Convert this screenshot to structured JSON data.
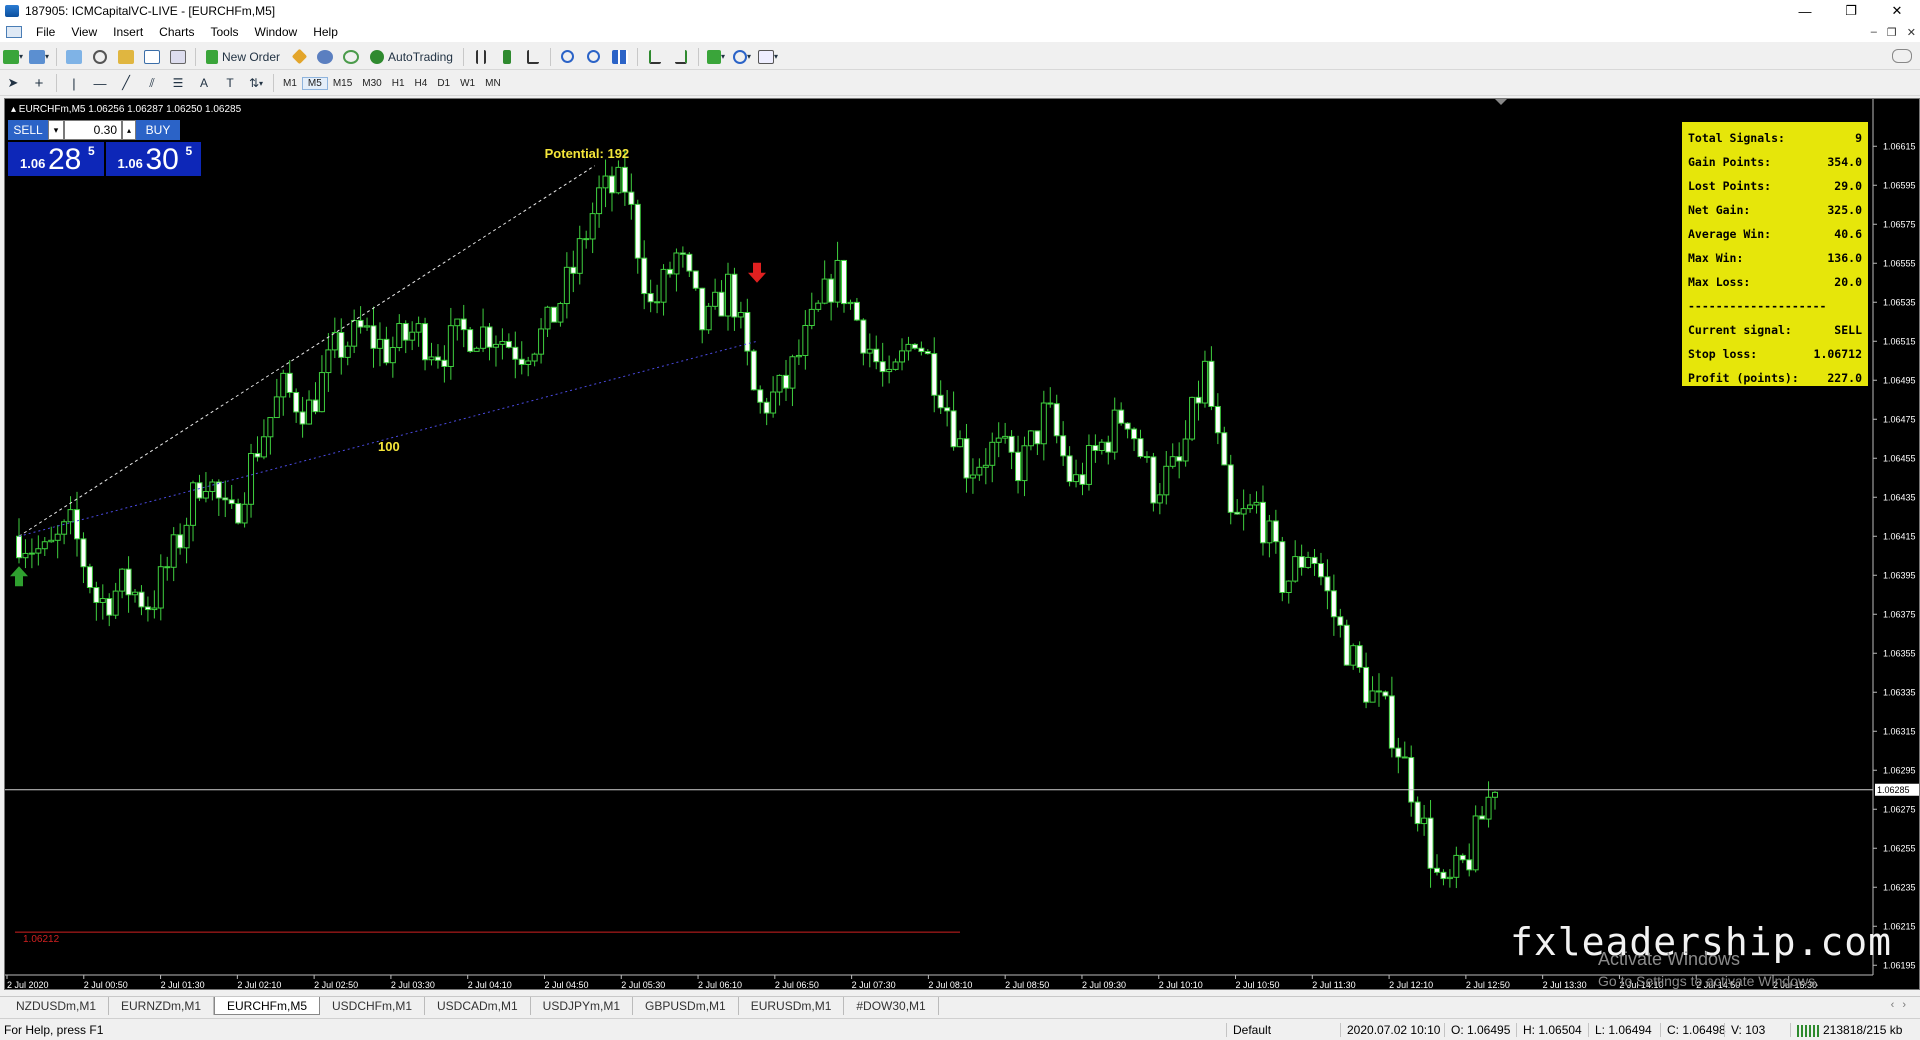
{
  "window": {
    "title": "187905: ICMCapitalVC-LIVE - [EURCHFm,M5]",
    "minimize": "—",
    "maximize": "❐",
    "close": "✕"
  },
  "menu": {
    "items": [
      "File",
      "View",
      "Insert",
      "Charts",
      "Tools",
      "Window",
      "Help"
    ]
  },
  "toolbar": {
    "new_order": "New Order",
    "auto_trading": "AutoTrading",
    "timeframes": [
      "M1",
      "M5",
      "M15",
      "M30",
      "H1",
      "H4",
      "D1",
      "W1",
      "MN"
    ],
    "active_timeframe": "M5"
  },
  "chart_header": {
    "symbol_info": "EURCHFm,M5  1.06256 1.06287 1.06250 1.06285"
  },
  "one_click": {
    "sell_label": "SELL",
    "buy_label": "BUY",
    "lot": "0.30",
    "sell_prefix": "1.06",
    "sell_big": "28",
    "sell_sup": "5",
    "buy_prefix": "1.06",
    "buy_big": "30",
    "buy_sup": "5"
  },
  "annotations": {
    "potential": "Potential: 192",
    "distance": "100",
    "red_line_price": "1.06212"
  },
  "stats": [
    {
      "label": "Total Signals:",
      "value": "9"
    },
    {
      "label": "Gain Points:",
      "value": "354.0"
    },
    {
      "label": "Lost Points:",
      "value": "29.0"
    },
    {
      "label": "Net Gain:",
      "value": "325.0"
    },
    {
      "label": "Average Win:",
      "value": "40.6"
    },
    {
      "label": "Max Win:",
      "value": "136.0"
    },
    {
      "label": "Max Loss:",
      "value": "20.0"
    },
    {
      "separator": "--------------------"
    },
    {
      "label": "Current signal:",
      "value": "SELL"
    },
    {
      "label": "Stop loss:",
      "value": "1.06712"
    },
    {
      "label": "Profit (points):",
      "value": "227.0"
    }
  ],
  "chart_data": {
    "type": "candlestick",
    "symbol": "EURCHFm",
    "timeframe": "M5",
    "ylim": [
      1.0619,
      1.0663
    ],
    "y_ticks": [
      "1.06615",
      "1.06595",
      "1.06575",
      "1.06555",
      "1.06535",
      "1.06515",
      "1.06495",
      "1.06475",
      "1.06455",
      "1.06435",
      "1.06415",
      "1.06395",
      "1.06375",
      "1.06355",
      "1.06335",
      "1.06315",
      "1.06295",
      "1.06275",
      "1.06255",
      "1.06235",
      "1.06215",
      "1.06195"
    ],
    "current_price": "1.06285",
    "x_ticks": [
      "2 Jul 2020",
      "2 Jul 00:50",
      "2 Jul 01:30",
      "2 Jul 02:10",
      "2 Jul 02:50",
      "2 Jul 03:30",
      "2 Jul 04:10",
      "2 Jul 04:50",
      "2 Jul 05:30",
      "2 Jul 06:10",
      "2 Jul 06:50",
      "2 Jul 07:30",
      "2 Jul 08:10",
      "2 Jul 08:50",
      "2 Jul 09:30",
      "2 Jul 10:10",
      "2 Jul 10:50",
      "2 Jul 11:30",
      "2 Jul 12:10",
      "2 Jul 12:50",
      "2 Jul 13:30",
      "2 Jul 14:10",
      "2 Jul 14:50",
      "2 Jul 15:30"
    ],
    "close_path": [
      1.06415,
      1.06405,
      1.0642,
      1.0638,
      1.0639,
      1.0638,
      1.0641,
      1.0645,
      1.0642,
      1.0646,
      1.0649,
      1.0648,
      1.0651,
      1.0652,
      1.0651,
      1.0652,
      1.0651,
      1.0652,
      1.0652,
      1.0651,
      1.0652,
      1.0655,
      1.0659,
      1.06595,
      1.0653,
      1.0656,
      1.0652,
      1.06545,
      1.0648,
      1.0649,
      1.0652,
      1.0655,
      1.0652,
      1.0649,
      1.0652,
      1.0649,
      1.0645,
      1.0646,
      1.0645,
      1.0648,
      1.0644,
      1.0646,
      1.0648,
      1.0644,
      1.0645,
      1.065,
      1.0642,
      1.0643,
      1.0639,
      1.0641,
      1.0637,
      1.0634,
      1.0632,
      1.0628,
      1.0623,
      1.0625,
      1.0629
    ],
    "lines": [
      {
        "from": [
          1.06415,
          0
        ],
        "to": [
          1.06605,
          0.39
        ],
        "style": "white-dashed"
      },
      {
        "from": [
          1.06415,
          0
        ],
        "to": [
          1.06515,
          0.5
        ],
        "style": "blue-dashed"
      }
    ],
    "signals": [
      {
        "type": "buy",
        "position": 0
      },
      {
        "type": "sell",
        "position": 0.5
      }
    ]
  },
  "watermark": "fxleadership.com",
  "activation": {
    "title": "Activate Windows",
    "subtitle": "Go to Settings to activate Windows."
  },
  "tabs": [
    "NZDUSDm,M1",
    "EURNZDm,M1",
    "EURCHFm,M5",
    "USDCHFm,M1",
    "USDCADm,M1",
    "USDJPYm,M1",
    "GBPUSDm,M1",
    "EURUSDm,M1",
    "#DOW30,M1"
  ],
  "active_tab": "EURCHFm,M5",
  "status": {
    "help": "For Help, press F1",
    "profile": "Default",
    "datetime": "2020.07.02 10:10",
    "open": "O: 1.06495",
    "high": "H: 1.06504",
    "low": "L: 1.06494",
    "close": "C: 1.06498",
    "volume": "V: 103",
    "traffic": "213818/215 kb"
  }
}
